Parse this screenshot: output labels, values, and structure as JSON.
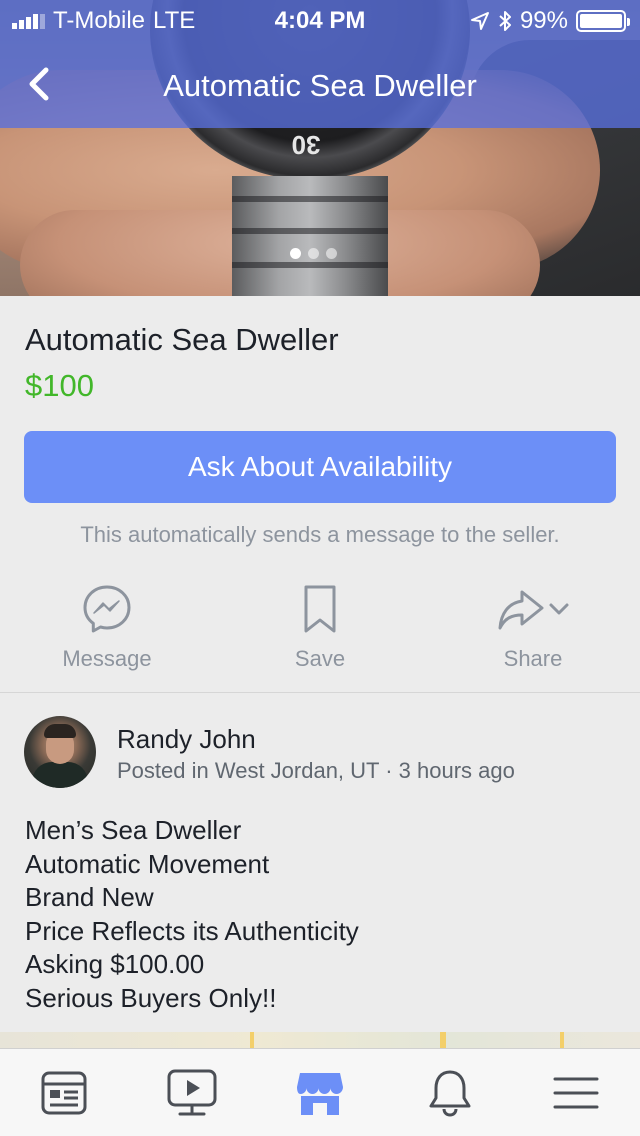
{
  "status_bar": {
    "carrier": "T-Mobile",
    "network": "LTE",
    "time": "4:04 PM",
    "battery": "99%"
  },
  "nav": {
    "title": "Automatic Sea Dweller"
  },
  "listing": {
    "photo_bezel_text": "30",
    "photo_count": 3,
    "photo_active_index": 0,
    "title": "Automatic Sea Dweller",
    "price": "$100",
    "ask_button": "Ask About Availability",
    "ask_note": "This automatically sends a message to the seller."
  },
  "actions": {
    "message": "Message",
    "save": "Save",
    "share": "Share"
  },
  "seller": {
    "name": "Randy John",
    "meta": "Posted in West Jordan, UT · 3 hours ago"
  },
  "description": [
    "Men’s Sea Dweller",
    "Automatic Movement",
    "Brand New",
    "Price Reflects its Authenticity",
    "Asking $100.00",
    "Serious Buyers Only!!"
  ],
  "colors": {
    "header_overlay": "#5870de",
    "ask_button": "#6c8ff7",
    "price": "#42b72a",
    "active_tab": "#6c8ff7",
    "inactive_tab": "#4b4f56"
  },
  "tabbar": {
    "items": [
      {
        "icon": "news-feed-icon",
        "active": false
      },
      {
        "icon": "watch-video-icon",
        "active": false
      },
      {
        "icon": "marketplace-icon",
        "active": true
      },
      {
        "icon": "notifications-bell-icon",
        "active": false
      },
      {
        "icon": "menu-icon",
        "active": false
      }
    ]
  }
}
